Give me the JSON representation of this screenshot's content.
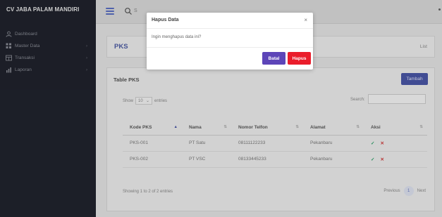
{
  "sidebar": {
    "brand": "CV JABA PALAM MANDIRI",
    "items": [
      {
        "label": "Dashboard",
        "icon": "user-icon",
        "has_submenu": false
      },
      {
        "label": "Master Data",
        "icon": "grid-icon",
        "has_submenu": true
      },
      {
        "label": "Transaksi",
        "icon": "table-icon",
        "has_submenu": true
      },
      {
        "label": "Laporan",
        "icon": "chart-icon",
        "has_submenu": true
      }
    ]
  },
  "topbar": {
    "search_placeholder": "S"
  },
  "page": {
    "title": "PKS",
    "crumb": "List"
  },
  "card": {
    "title": "Table PKS",
    "add_label": "Tambah",
    "show_label": "Show",
    "entries_value": "10",
    "entries_label": "entries",
    "search_label": "Search:",
    "columns": [
      "Kode PKS",
      "Nama",
      "Nomor Telfon",
      "Alamat",
      "Aksi"
    ],
    "rows": [
      {
        "kode": "PKS-001",
        "nama": "PT Satu",
        "telfon": "08111122233",
        "alamat": "Pekanbaru"
      },
      {
        "kode": "PKS-002",
        "nama": "PT VSC",
        "telfon": "08133445233",
        "alamat": "Pekanbaru"
      }
    ],
    "info": "Showing 1 to 2 of 2 entries",
    "prev_label": "Previous",
    "page_number": "1",
    "next_label": "Next"
  },
  "modal": {
    "title": "Hapus Data",
    "close": "×",
    "message": "Ingin menghapus data ini?",
    "cancel_label": "Batal",
    "confirm_label": "Hapus"
  },
  "colors": {
    "sidebar_bg": "#20232d",
    "accent": "#4b57a8",
    "batal": "#5d45b8",
    "hapus": "#ea1d2b"
  }
}
